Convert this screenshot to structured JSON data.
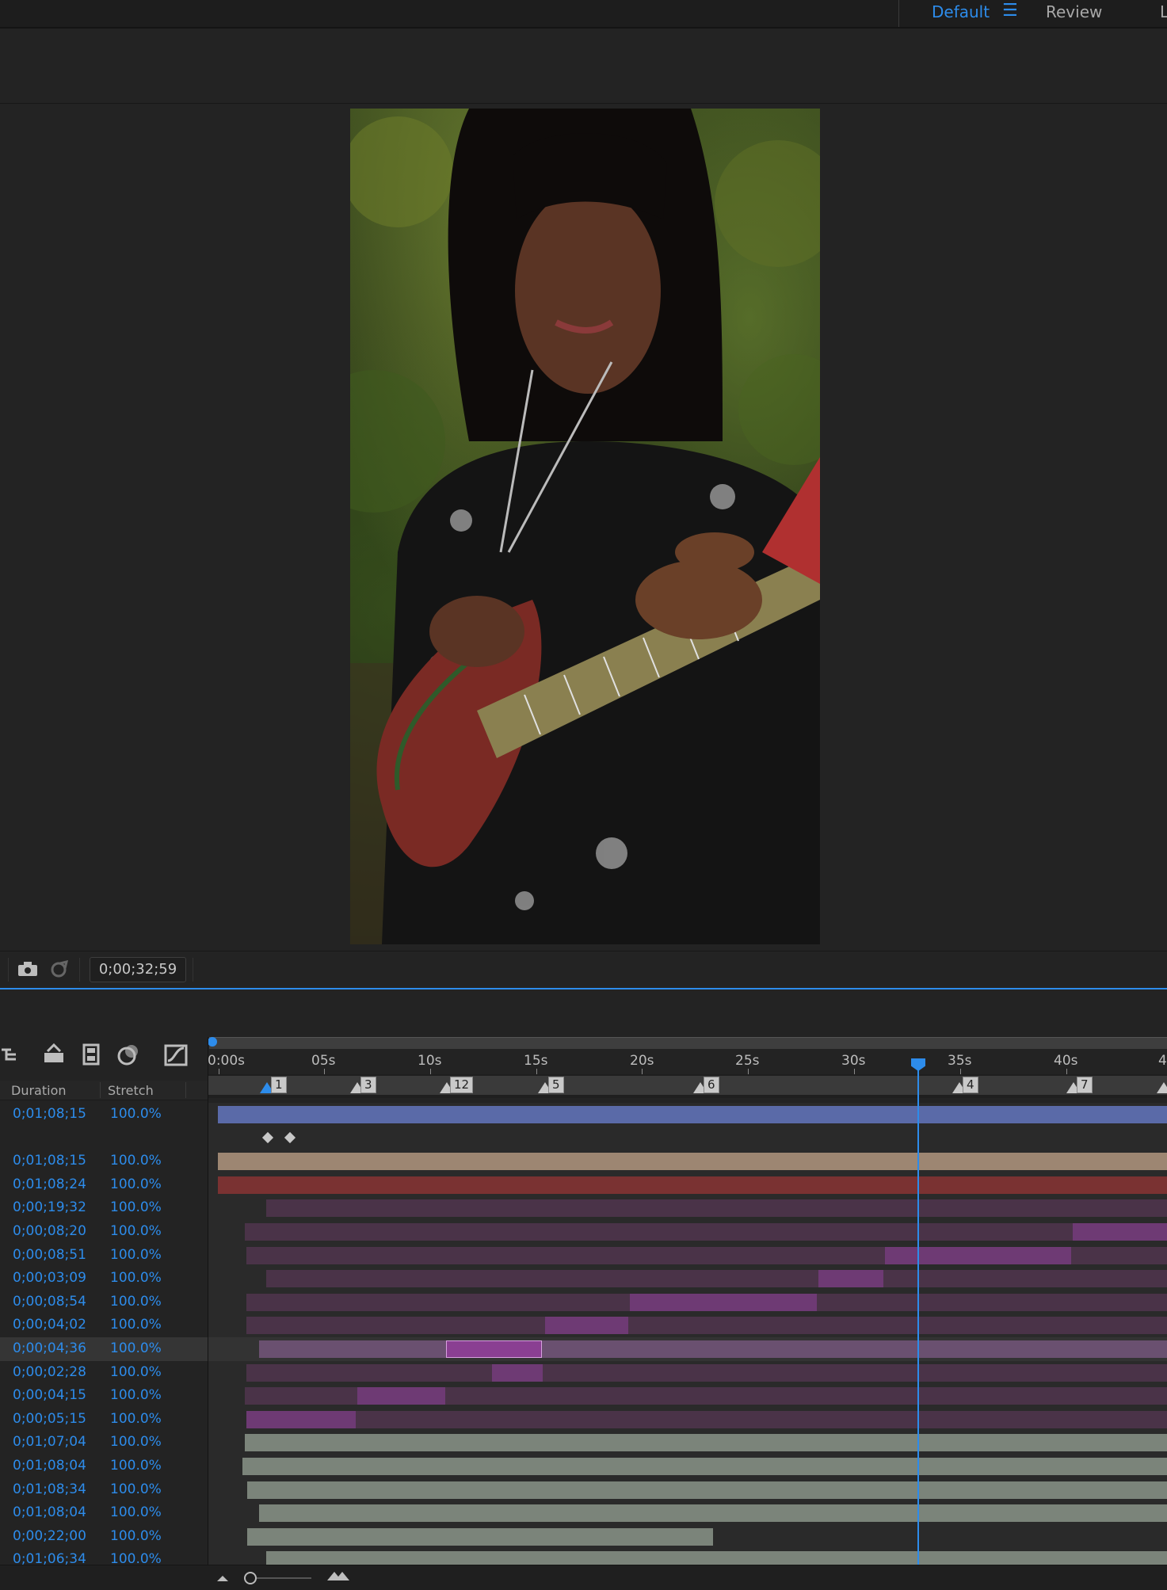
{
  "workspaces": {
    "default": "Default",
    "menu_icon": "hamburger-icon",
    "review": "Review",
    "cut": "L"
  },
  "viewer": {
    "timecode": "0;00;32;59",
    "snapshot_icon": "camera-icon",
    "show_snapshot_icon": "snapshot-icon"
  },
  "timeline": {
    "columns": {
      "duration": "Duration",
      "stretch": "Stretch"
    },
    "ruler": [
      "0:00s",
      "05s",
      "10s",
      "15s",
      "20s",
      "25s",
      "30s",
      "35s",
      "40s",
      "4"
    ],
    "markers": [
      "1",
      "3",
      "12",
      "5",
      "6",
      "4",
      "7"
    ],
    "rows": [
      {
        "duration": "0;01;08;15",
        "stretch": "100.0%"
      },
      {
        "duration": "",
        "stretch": ""
      },
      {
        "duration": "0;01;08;15",
        "stretch": "100.0%"
      },
      {
        "duration": "0;01;08;24",
        "stretch": "100.0%"
      },
      {
        "duration": "0;00;19;32",
        "stretch": "100.0%"
      },
      {
        "duration": "0;00;08;20",
        "stretch": "100.0%"
      },
      {
        "duration": "0;00;08;51",
        "stretch": "100.0%"
      },
      {
        "duration": "0;00;03;09",
        "stretch": "100.0%"
      },
      {
        "duration": "0;00;08;54",
        "stretch": "100.0%"
      },
      {
        "duration": "0;00;04;02",
        "stretch": "100.0%"
      },
      {
        "duration": "0;00;04;36",
        "stretch": "100.0%"
      },
      {
        "duration": "0;00;02;28",
        "stretch": "100.0%"
      },
      {
        "duration": "0;00;04;15",
        "stretch": "100.0%"
      },
      {
        "duration": "0;00;05;15",
        "stretch": "100.0%"
      },
      {
        "duration": "0;01;07;04",
        "stretch": "100.0%"
      },
      {
        "duration": "0;01;08;04",
        "stretch": "100.0%"
      },
      {
        "duration": "0;01;08;34",
        "stretch": "100.0%"
      },
      {
        "duration": "0;01;08;04",
        "stretch": "100.0%"
      },
      {
        "duration": "0;00;22;00",
        "stretch": "100.0%"
      },
      {
        "duration": "0;01;06;34",
        "stretch": "100.0%"
      }
    ]
  },
  "colors": {
    "accent": "#2d8ceb",
    "background": "#232323"
  }
}
